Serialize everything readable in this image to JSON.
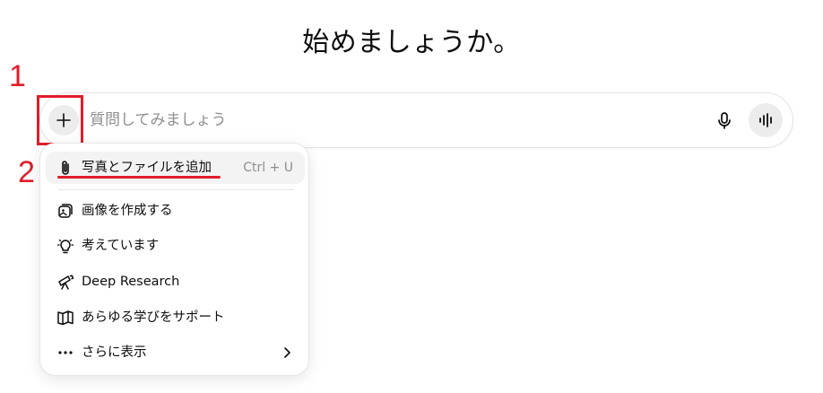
{
  "heading": "始めましょうか。",
  "annotations": {
    "step1": "1",
    "step2": "2"
  },
  "composer": {
    "placeholder": "質問してみましょう"
  },
  "menu": {
    "items": [
      {
        "label": "写真とファイルを追加",
        "shortcut": "Ctrl + U",
        "icon": "paperclip-icon"
      },
      {
        "label": "画像を作成する",
        "icon": "image-create-icon"
      },
      {
        "label": "考えています",
        "icon": "lightbulb-icon"
      },
      {
        "label": "Deep Research",
        "icon": "telescope-icon"
      },
      {
        "label": "あらゆる学びをサポート",
        "icon": "book-icon"
      },
      {
        "label": "さらに表示",
        "icon": "more-dots-icon"
      }
    ]
  },
  "colors": {
    "annotation": "#e11d2a",
    "button_bg": "#ececec",
    "placeholder": "#8e8e8e"
  }
}
